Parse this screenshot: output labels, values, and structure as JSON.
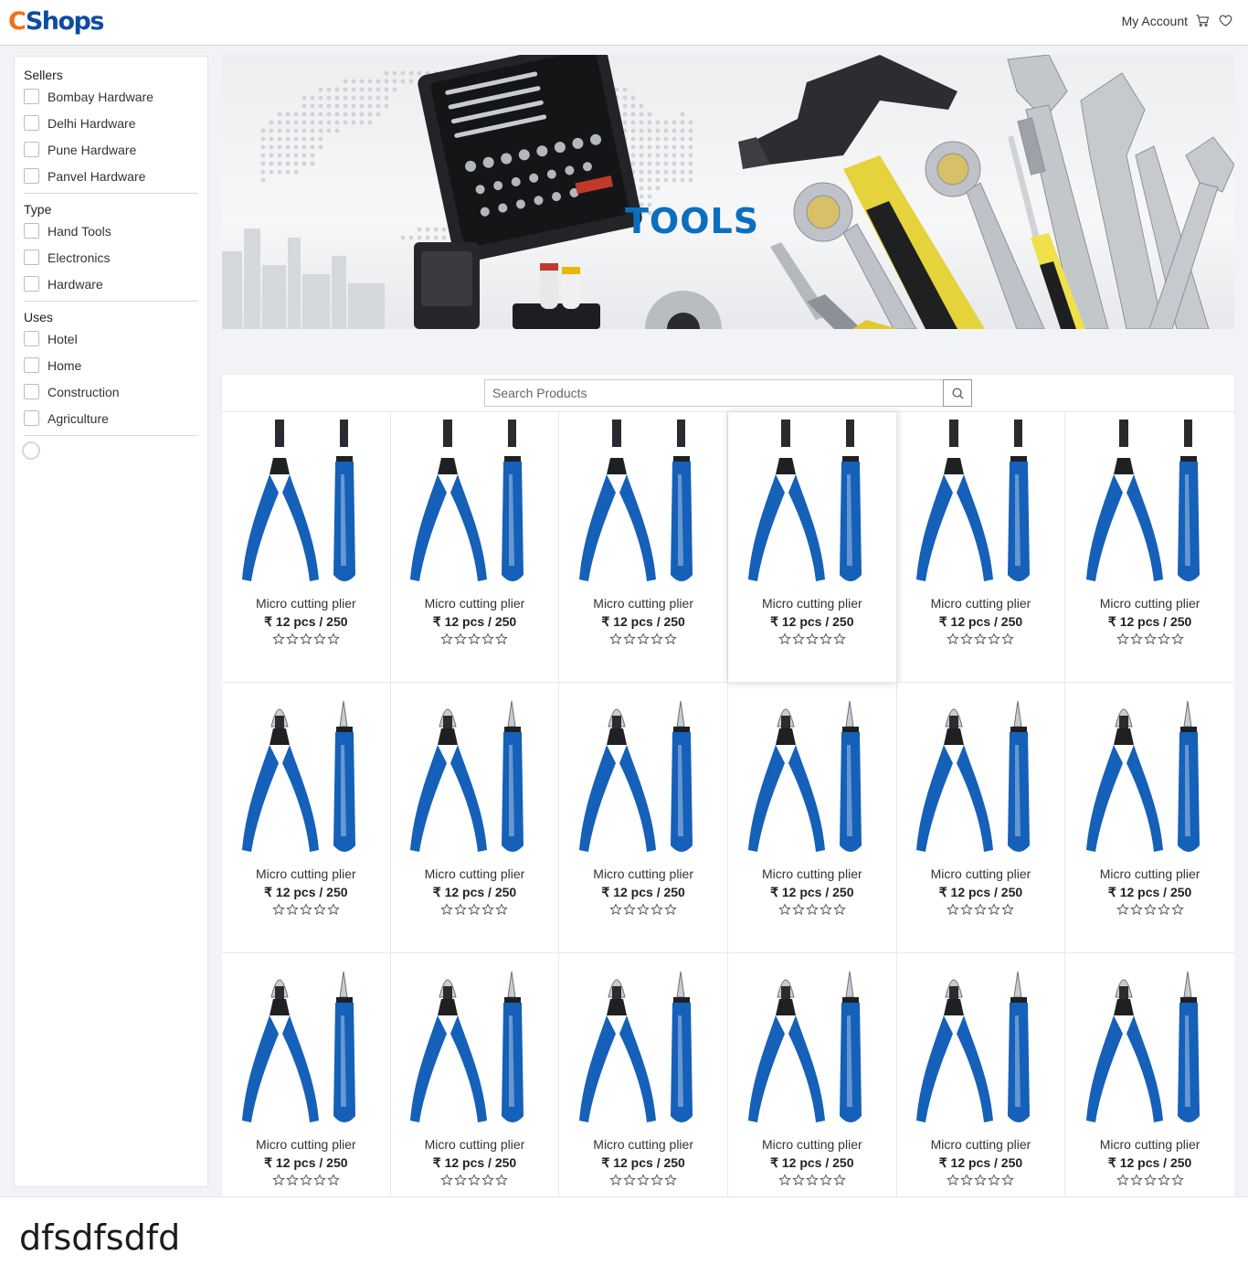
{
  "header": {
    "logo_c": "C",
    "logo_rest": "Shops",
    "my_account": "My Account",
    "cart_icon": "cart-icon",
    "wishlist_icon": "heart-icon",
    "brand_orange": "#f36f21",
    "brand_blue": "#0c4da2"
  },
  "filters": {
    "sellers": {
      "title": "Sellers",
      "options": [
        "Bombay Hardware",
        "Delhi Hardware",
        "Pune Hardware",
        "Panvel Hardware"
      ]
    },
    "type": {
      "title": "Type",
      "options": [
        "Hand Tools",
        "Electronics",
        "Hardware"
      ]
    },
    "uses": {
      "title": "Uses",
      "options": [
        "Hotel",
        "Home",
        "Construction",
        "Agriculture"
      ]
    }
  },
  "banner": {
    "title": "TOOLS",
    "title_color": "#0a6fbf"
  },
  "search": {
    "placeholder": "Search Products",
    "icon": "search-icon"
  },
  "products": [
    {
      "name": "Micro cutting plier",
      "price": "₹ 12 pcs / 250",
      "rating": 0
    },
    {
      "name": "Micro cutting plier",
      "price": "₹ 12 pcs / 250",
      "rating": 0
    },
    {
      "name": "Micro cutting plier",
      "price": "₹ 12 pcs / 250",
      "rating": 0
    },
    {
      "name": "Micro cutting plier",
      "price": "₹ 12 pcs / 250",
      "rating": 0
    },
    {
      "name": "Micro cutting plier",
      "price": "₹ 12 pcs / 250",
      "rating": 0
    },
    {
      "name": "Micro cutting plier",
      "price": "₹ 12 pcs / 250",
      "rating": 0
    },
    {
      "name": "Micro cutting plier",
      "price": "₹ 12 pcs / 250",
      "rating": 0
    },
    {
      "name": "Micro cutting plier",
      "price": "₹ 12 pcs / 250",
      "rating": 0
    },
    {
      "name": "Micro cutting plier",
      "price": "₹ 12 pcs / 250",
      "rating": 0
    },
    {
      "name": "Micro cutting plier",
      "price": "₹ 12 pcs / 250",
      "rating": 0
    },
    {
      "name": "Micro cutting plier",
      "price": "₹ 12 pcs / 250",
      "rating": 0
    },
    {
      "name": "Micro cutting plier",
      "price": "₹ 12 pcs / 250",
      "rating": 0
    },
    {
      "name": "Micro cutting plier",
      "price": "₹ 12 pcs / 250",
      "rating": 0
    },
    {
      "name": "Micro cutting plier",
      "price": "₹ 12 pcs / 250",
      "rating": 0
    },
    {
      "name": "Micro cutting plier",
      "price": "₹ 12 pcs / 250",
      "rating": 0
    },
    {
      "name": "Micro cutting plier",
      "price": "₹ 12 pcs / 250",
      "rating": 0
    },
    {
      "name": "Micro cutting plier",
      "price": "₹ 12 pcs / 250",
      "rating": 0
    },
    {
      "name": "Micro cutting plier",
      "price": "₹ 12 pcs / 250",
      "rating": 0
    }
  ],
  "product_handle_color": "#1560b8",
  "footer": {
    "text": "dfsdfsdfd"
  }
}
